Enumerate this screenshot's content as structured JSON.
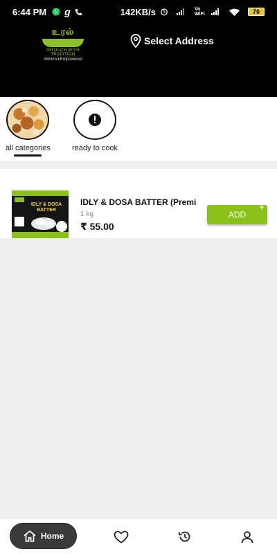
{
  "status_bar": {
    "time": "6:44 PM",
    "app_letter": "g",
    "net_speed": "142KB/s",
    "volte": "Vo WiFi",
    "battery": "70"
  },
  "header": {
    "logo": {
      "brand": "உரல்",
      "tagline": "INTOUCH WITH TRADITION",
      "hashtag": "#WomenEmpowered"
    },
    "address_label": "Select Address"
  },
  "categories": [
    {
      "label": "all categories",
      "selected": true,
      "icon": "food-platter-image"
    },
    {
      "label": "ready to cook",
      "selected": false,
      "icon": "exclamation-icon"
    }
  ],
  "products": [
    {
      "name": "IDLY & DOSA BATTER (Premium)",
      "quantity": "1 kg",
      "price": "₹ 55.00",
      "add_label": "ADD",
      "add_plus": "+",
      "image_text": "IDLY & DOSA BATTER"
    }
  ],
  "bottom_nav": {
    "home_label": "Home",
    "items": [
      "home-icon",
      "heart-icon",
      "history-icon",
      "user-icon"
    ]
  },
  "colors": {
    "accent_green": "#8ac11c",
    "header_bg": "#000000"
  }
}
